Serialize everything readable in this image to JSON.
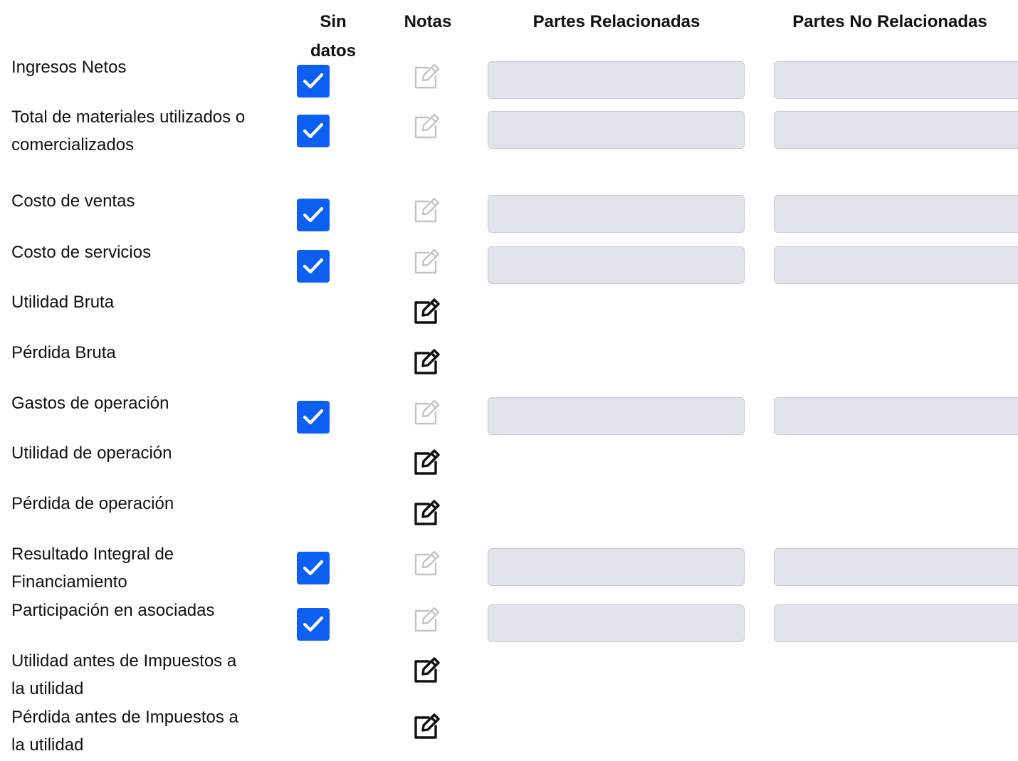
{
  "headers": {
    "sin_datos": "Sin datos",
    "notas": "Notas",
    "partes_relacionadas": "Partes Relacionadas",
    "partes_no_relacionadas": "Partes No Relacionadas"
  },
  "colors": {
    "checkbox": "#0d5ff2",
    "input_disabled_bg": "#e1e5eb",
    "icon_disabled": "#c4c4c4",
    "icon_enabled": "#111111"
  },
  "icons": {
    "checkbox": "check-icon",
    "notes": "edit-icon"
  },
  "rows": [
    {
      "label": "Ingresos Netos",
      "sin_datos_checked": true,
      "notes_enabled": false,
      "partes_relacionadas_value": "",
      "partes_no_relacionadas_value": ""
    },
    {
      "label": "Total de materiales utilizados o comercializados",
      "sin_datos_checked": true,
      "notes_enabled": false,
      "partes_relacionadas_value": "",
      "partes_no_relacionadas_value": ""
    },
    {
      "label": "Costo de ventas",
      "sin_datos_checked": true,
      "notes_enabled": false,
      "partes_relacionadas_value": "",
      "partes_no_relacionadas_value": ""
    },
    {
      "label": "Costo de servicios",
      "sin_datos_checked": true,
      "notes_enabled": false,
      "partes_relacionadas_value": "",
      "partes_no_relacionadas_value": ""
    },
    {
      "label": "Utilidad Bruta",
      "notes_enabled": true
    },
    {
      "label": "Pérdida Bruta",
      "notes_enabled": true
    },
    {
      "label": "Gastos de operación",
      "sin_datos_checked": true,
      "notes_enabled": false,
      "partes_relacionadas_value": "",
      "partes_no_relacionadas_value": ""
    },
    {
      "label": "Utilidad de operación",
      "notes_enabled": true
    },
    {
      "label": "Pérdida de operación",
      "notes_enabled": true
    },
    {
      "label": "Resultado Integral de Financiamiento",
      "sin_datos_checked": true,
      "notes_enabled": false,
      "partes_relacionadas_value": "",
      "partes_no_relacionadas_value": ""
    },
    {
      "label": "Participación en asociadas",
      "sin_datos_checked": true,
      "notes_enabled": false,
      "partes_relacionadas_value": "",
      "partes_no_relacionadas_value": ""
    },
    {
      "label": "Utilidad antes de Impuestos a la utilidad",
      "notes_enabled": true
    },
    {
      "label": "Pérdida antes de Impuestos a la utilidad",
      "notes_enabled": true
    }
  ]
}
